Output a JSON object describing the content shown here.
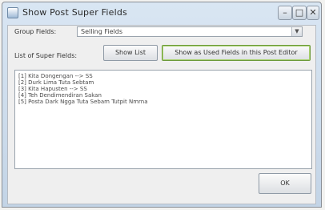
{
  "window": {
    "title": "Show Post Super Fields",
    "min_glyph": "–",
    "max_glyph": "□",
    "close_glyph": "✕"
  },
  "form": {
    "group_label": "Group Fields:",
    "group_value": "Selling Fields",
    "list_label": "List of Super Fields:",
    "show_list_label": "Show List",
    "show_all_label": "Show as Used Fields in this Post Editor",
    "ok_label": "OK"
  },
  "list": {
    "lines": [
      "[1] Kita Dongengan --> SS",
      "[2] Durk Lima Tuta Sebtam",
      "[3] Kita Hapusten --> SS",
      "[4] Teh Dendimendiran Sakan",
      "[5] Posta Dark Ngga Tuta Sebam Tutpit Nmrna"
    ]
  }
}
